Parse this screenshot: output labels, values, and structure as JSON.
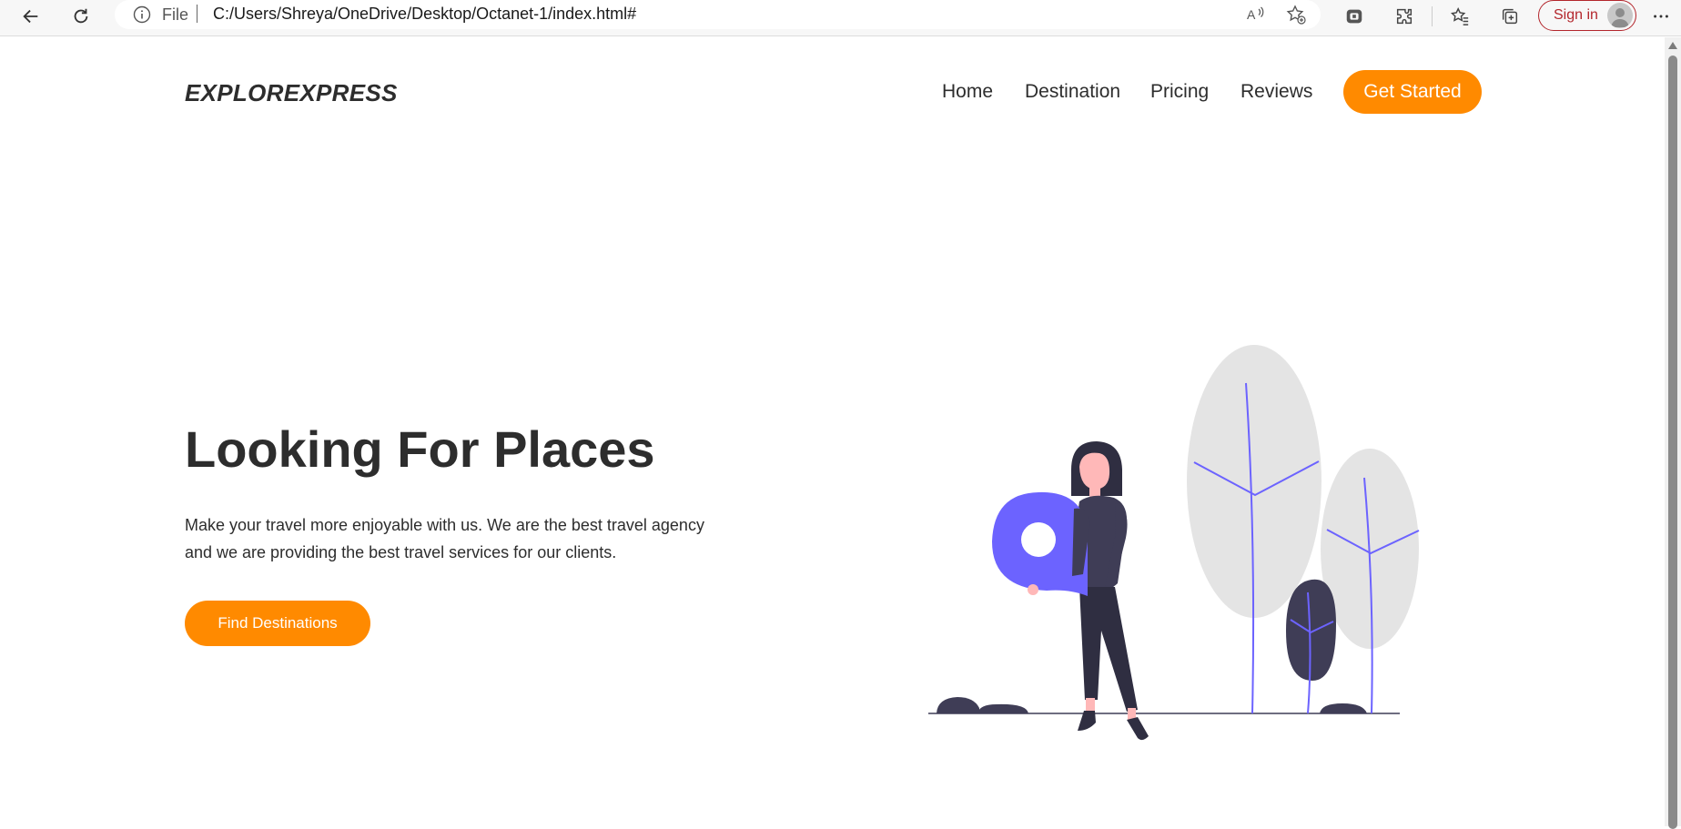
{
  "browser": {
    "protocol_label": "File",
    "url": "C:/Users/Shreya/OneDrive/Desktop/Octanet-1/index.html#",
    "signin_label": "Sign in",
    "icons": [
      "back-arrow-icon",
      "refresh-icon",
      "info-icon",
      "read-aloud-icon",
      "add-favorite-icon",
      "copilot-icon",
      "extensions-icon",
      "favorites-icon",
      "collections-icon",
      "more-menu-icon"
    ]
  },
  "header": {
    "logo": "EXPLOREXPRESS",
    "nav": [
      "Home",
      "Destination",
      "Pricing",
      "Reviews"
    ],
    "cta_label": "Get Started"
  },
  "hero": {
    "title": "Looking For Places",
    "description": "Make your travel more enjoyable with us. We are the best travel agency and we are providing the best travel services for our clients.",
    "button_label": "Find Destinations"
  },
  "colors": {
    "accent": "#ff8a00",
    "text": "#2d2d2d",
    "illustration_primary": "#6c63ff",
    "illustration_dark": "#3f3d56",
    "tree_fill": "#e4e4e4",
    "skin": "#ffb8b8"
  }
}
